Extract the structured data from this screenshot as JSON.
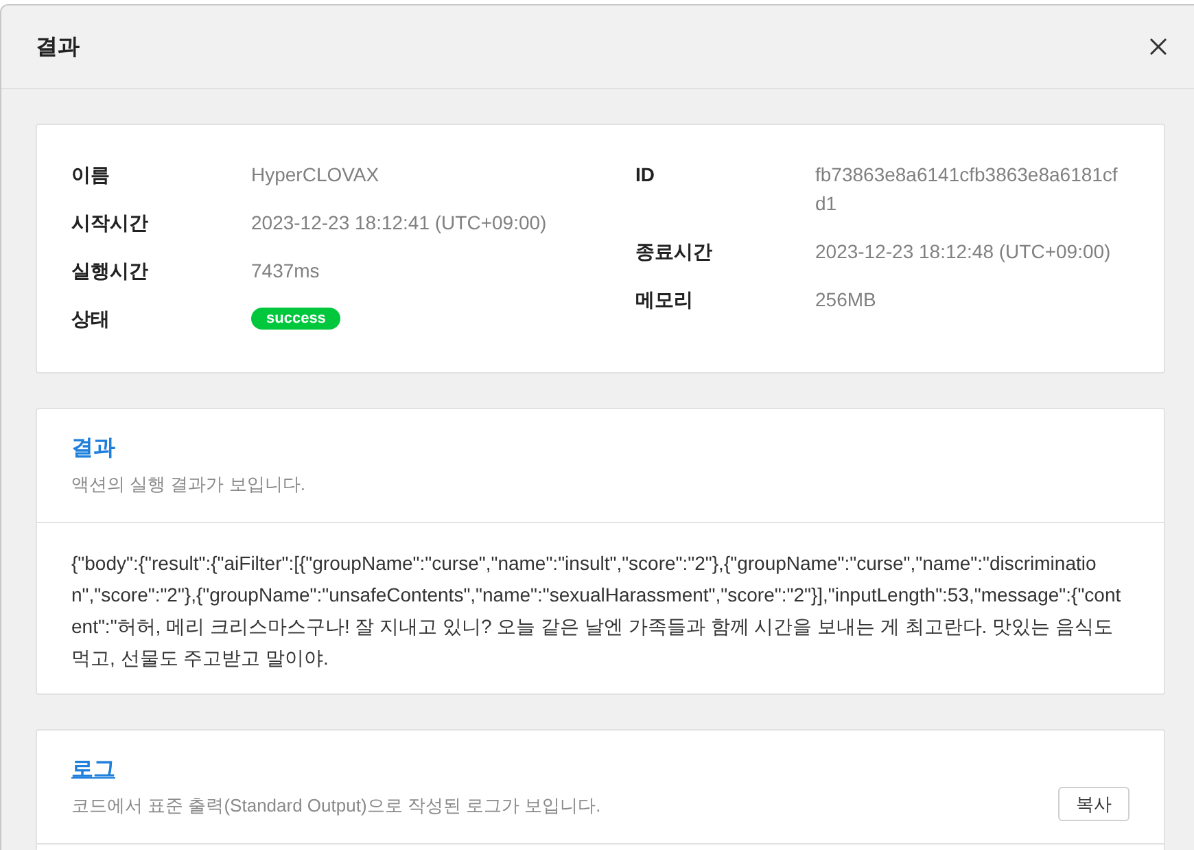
{
  "dialog": {
    "title": "결과"
  },
  "summary": {
    "left": [
      {
        "label": "이름",
        "value": "HyperCLOVAX",
        "kind": "text"
      },
      {
        "label": "시작시간",
        "value": "2023-12-23 18:12:41 (UTC+09:00)",
        "kind": "text"
      },
      {
        "label": "실행시간",
        "value": "7437ms",
        "kind": "text"
      },
      {
        "label": "상태",
        "value": "success",
        "kind": "badge"
      }
    ],
    "right": [
      {
        "label": "ID",
        "value": "fb73863e8a6141cfb3863e8a6181cfd1",
        "kind": "text"
      },
      {
        "label": "종료시간",
        "value": "2023-12-23 18:12:48 (UTC+09:00)",
        "kind": "text"
      },
      {
        "label": "메모리",
        "value": "256MB",
        "kind": "text"
      }
    ]
  },
  "result": {
    "title": "결과",
    "subtitle": "액션의 실행 결과가 보입니다.",
    "hovered": false,
    "output": "{\"body\":{\"result\":{\"aiFilter\":[{\"groupName\":\"curse\",\"name\":\"insult\",\"score\":\"2\"},{\"groupName\":\"curse\",\"name\":\"discrimination\",\"score\":\"2\"},{\"groupName\":\"unsafeContents\",\"name\":\"sexualHarassment\",\"score\":\"2\"}],\"inputLength\":53,\"message\":{\"content\":\"허허, 메리 크리스마스구나! 잘 지내고 있니? 오늘 같은 날엔 가족들과 함께 시간을 보내는 게 최고란다. 맛있는 음식도 먹고, 선물도 주고받고 말이야."
  },
  "log": {
    "title": "로그",
    "subtitle": "코드에서 표준 출력(Standard Output)으로 작성된 로그가 보입니다.",
    "hovered": true,
    "copy_button": "복사"
  }
}
